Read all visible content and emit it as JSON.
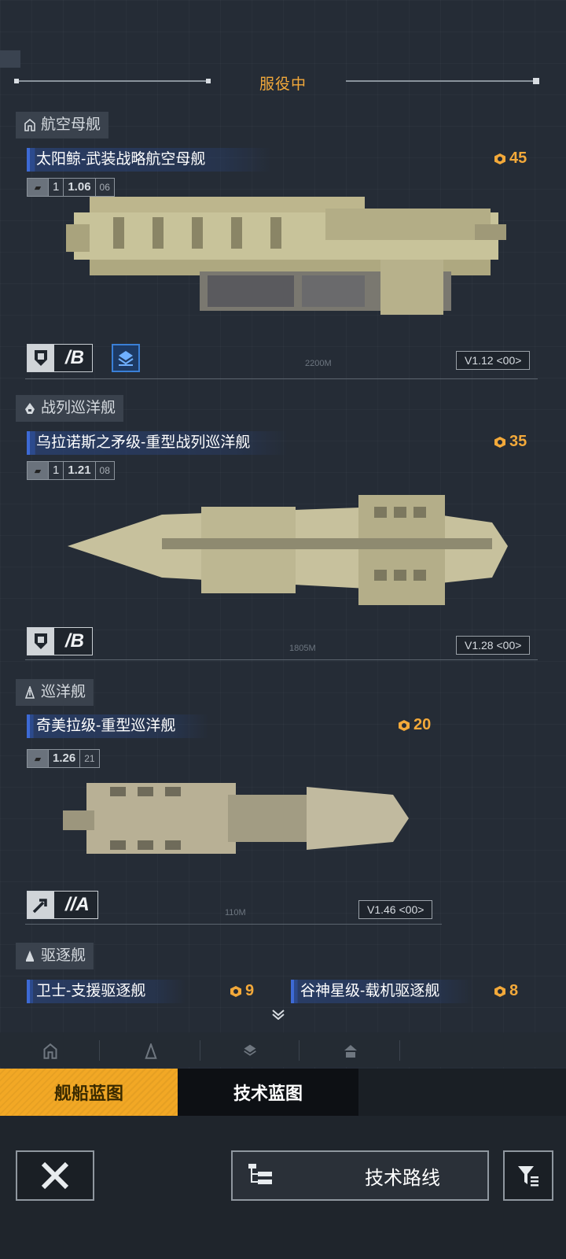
{
  "header": {
    "title": "服役中"
  },
  "categories": [
    {
      "label": "航空母舰",
      "icon": "carrier-icon"
    },
    {
      "label": "战列巡洋舰",
      "icon": "battlecruiser-icon"
    },
    {
      "label": "巡洋舰",
      "icon": "cruiser-icon"
    },
    {
      "label": "驱逐舰",
      "icon": "destroyer-icon"
    }
  ],
  "ships": [
    {
      "name": "太阳鲸-武装战略航空母舰",
      "cost": "45",
      "ver_a": "1",
      "ver_b": "1.06",
      "ver_c": "06",
      "grade": "/B",
      "length": "2200M",
      "version": "V1.12  <00>",
      "hull_color": "#c8c39a"
    },
    {
      "name": "乌拉诺斯之矛级-重型战列巡洋舰",
      "cost": "35",
      "ver_a": "1",
      "ver_b": "1.21",
      "ver_c": "08",
      "grade": "/B",
      "length": "1805M",
      "version": "V1.28  <00>",
      "hull_color": "#c7c19d"
    },
    {
      "name": "奇美拉级-重型巡洋舰",
      "cost": "20",
      "ver_b": "1.26",
      "ver_c": "21",
      "grade": "//A",
      "length": "110M",
      "version": "V1.46  <00>",
      "hull_color": "#b8b095"
    }
  ],
  "destroyers": [
    {
      "name": "卫士-支援驱逐舰",
      "cost": "9"
    },
    {
      "name": "谷神星级-载机驱逐舰",
      "cost": "8"
    }
  ],
  "tabs": {
    "ship_blueprint": "舰船蓝图",
    "tech_blueprint": "技术蓝图"
  },
  "footer": {
    "tech_route": "技术路线"
  },
  "colors": {
    "accent": "#f3a93a",
    "blue": "#2c4a8c",
    "tab_active": "#f2a825"
  }
}
